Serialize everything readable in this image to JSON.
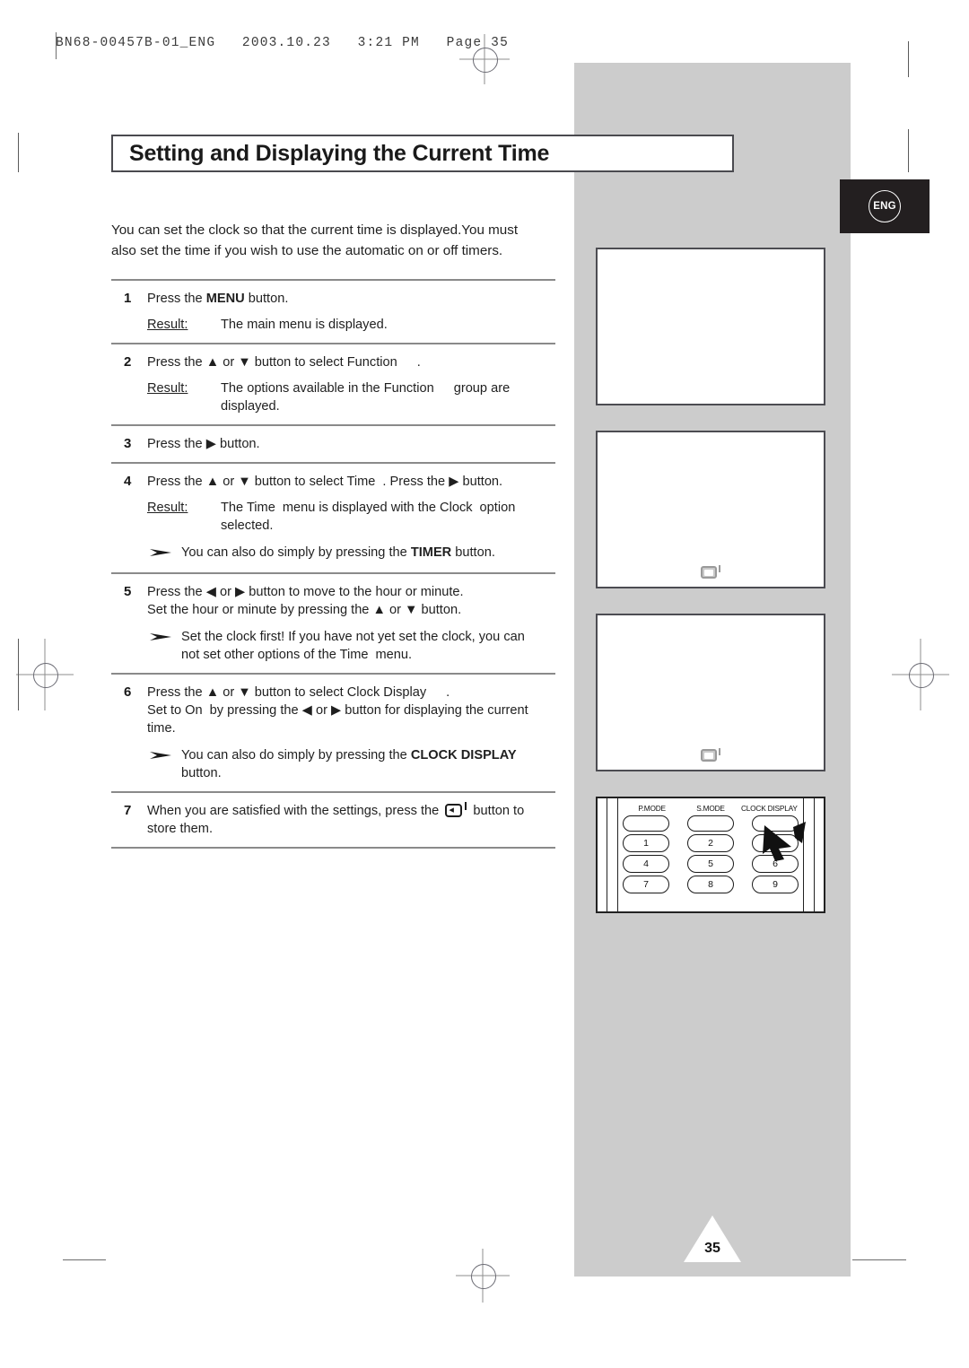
{
  "prepress": {
    "header_line": "BN68-00457B-01_ENG   2003.10.23   3:21 PM   Page 35"
  },
  "language_tab": {
    "label": "ENG"
  },
  "page": {
    "title": "Setting and Displaying the Current Time",
    "number": "35"
  },
  "intro": {
    "line1": "You can set the clock so that the current time is displayed.You must",
    "line2": "also set the time if you wish to use the automatic on or off timers."
  },
  "steps": [
    {
      "num": "1",
      "lines": [
        "Press the MENU button."
      ],
      "result_label": "Result:",
      "result_text": "The main menu is displayed.",
      "note": null
    },
    {
      "num": "2",
      "lines": [
        "Press the ▲ or ▼ button to select Function  ."
      ],
      "result_label": "Result:",
      "result_text": "The options available in the Function    group are displayed.",
      "note": null
    },
    {
      "num": "3",
      "lines": [
        "Press the ▶ button."
      ],
      "result_label": null,
      "result_text": null,
      "note": null
    },
    {
      "num": "4",
      "lines": [
        "Press the ▲ or ▼ button to select Time . Press the ▶ button."
      ],
      "result_label": "Result:",
      "result_text": "The Time  menu is displayed with the Clock   option selected.",
      "note": "You can also do simply by pressing the TIMER button."
    },
    {
      "num": "5",
      "lines": [
        "Press the ◀ or ▶ button to move to the hour or minute.",
        "Set the hour or minute by pressing the ▲ or ▼ button."
      ],
      "result_label": null,
      "result_text": null,
      "note": "Set the clock first! If you have not yet set the clock, you can not set other options of the Time  menu."
    },
    {
      "num": "6",
      "lines": [
        "Press the ▲ or ▼ button to select Clock Display     .",
        "Set to On by pressing the ◀ or ▶ button for displaying the current time."
      ],
      "result_label": null,
      "result_text": null,
      "note": "You can also do simply by pressing the CLOCK DISPLAY button."
    },
    {
      "num": "7",
      "lines": [
        "When you are satisfied with the settings, press the ⏎ button to store them."
      ],
      "result_label": null,
      "result_text": null,
      "note": null
    }
  ],
  "step_text": {
    "s1_a": "Press the ",
    "s1_menu": "MENU",
    "s1_b": " button.",
    "s1_result_label": "Result:",
    "s1_result": "The main menu is displayed.",
    "s2_a": "Press the ▲ or ▼ button to select Function",
    "s2_b": ".",
    "s2_result_label": "Result:",
    "s2_result_a": "The options available in the Function",
    "s2_result_b": "group are",
    "s2_result_c": "displayed.",
    "s3_a": "Press the ▶ button.",
    "s4_a": "Press the ▲ or ▼ button to select Time",
    "s4_b": ". Press the ▶ button.",
    "s4_result_label": "Result:",
    "s4_result_a": "The Time",
    "s4_result_b": "menu is displayed with the Clock",
    "s4_result_c": "option",
    "s4_result_d": "selected.",
    "s4_note_a": "You can also do simply by pressing the ",
    "s4_note_timer": "TIMER",
    "s4_note_b": " button.",
    "s5_a": "Press the ◀ or ▶ button to move to the hour or minute.",
    "s5_b": "Set the hour or minute by pressing the ▲ or ▼ button.",
    "s5_note_a": "Set the clock first! If you have not yet set the clock, you can",
    "s5_note_b": "not set other options of the Time",
    "s5_note_c": "menu.",
    "s6_a": "Press the ▲ or ▼ button to select Clock Display",
    "s6_b": ".",
    "s6_c": "Set to On",
    "s6_d": "by pressing the ◀ or ▶ button for displaying the current",
    "s6_e": "time.",
    "s6_note_a": "You can also do simply by pressing the ",
    "s6_note_clock": "CLOCK DISPLAY",
    "s6_note_b": "button.",
    "s7_a": "When you are satisfied with the settings, press the",
    "s7_b": "button to",
    "s7_c": "store them."
  },
  "remote": {
    "labels": [
      "P.MODE",
      "S.MODE",
      "CLOCK DISPLAY"
    ],
    "blank_row": [
      "",
      "",
      ""
    ],
    "num_rows": [
      [
        "1",
        "2",
        "3"
      ],
      [
        "4",
        "5",
        "6"
      ],
      [
        "7",
        "8",
        "9"
      ]
    ],
    "pointer": "cursor-arrow"
  },
  "screens": [
    {
      "name": "osd-screen-1",
      "icon": null
    },
    {
      "name": "osd-screen-2",
      "icon": "enter-key-icon"
    },
    {
      "name": "osd-screen-3",
      "icon": "enter-key-icon"
    }
  ],
  "colors": {
    "panel_grey": "#cccccc",
    "tab_dark": "#231f20",
    "rule_grey": "#8a8a8a",
    "text": "#1f1f1f"
  }
}
